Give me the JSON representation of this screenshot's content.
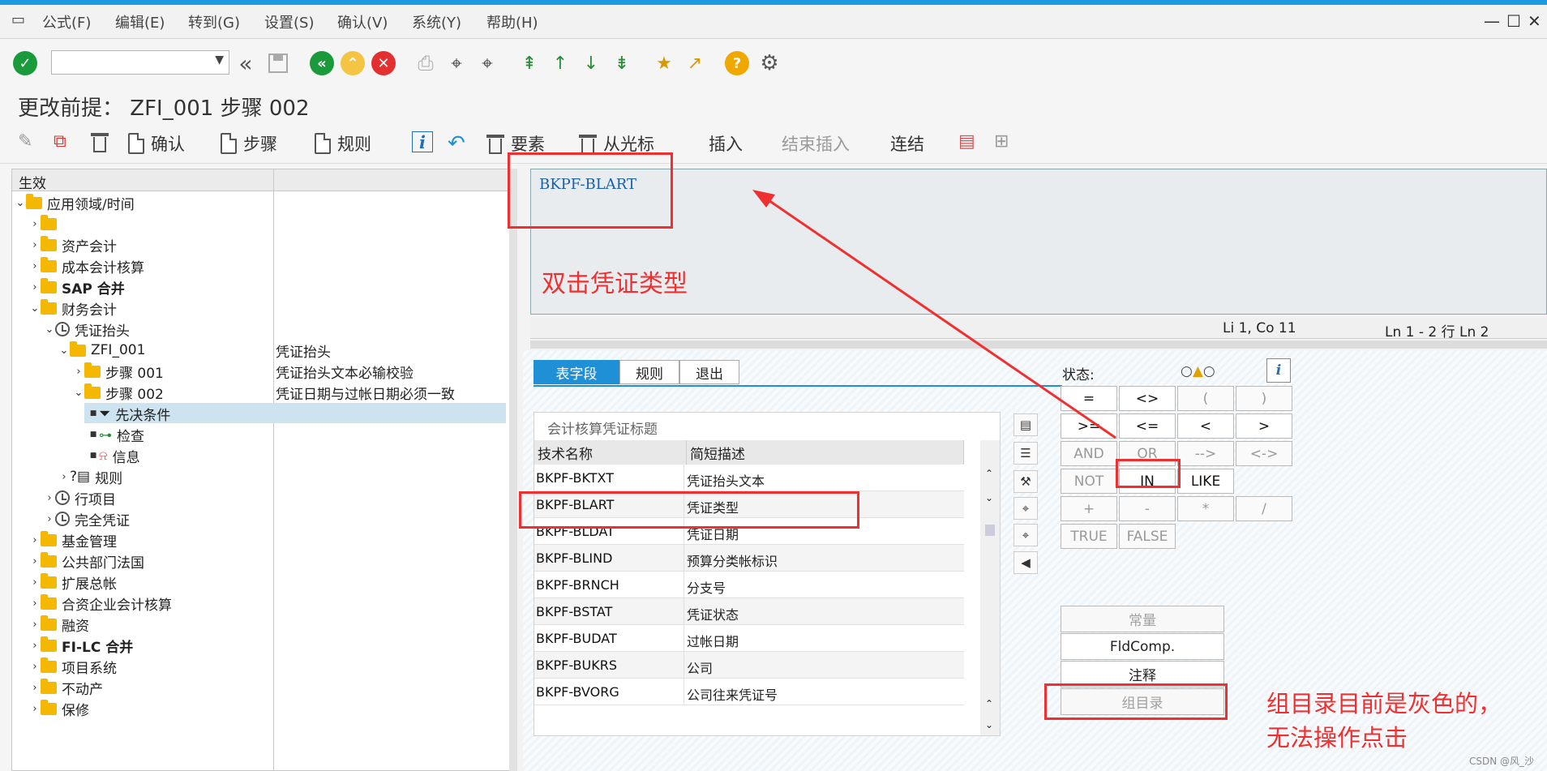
{
  "menu": [
    "公式(F)",
    "编辑(E)",
    "转到(G)",
    "设置(S)",
    "确认(V)",
    "系统(Y)",
    "帮助(H)"
  ],
  "title": "更改前提： ZFI_001 步骤 002",
  "app_toolbar": {
    "confirm": "确认",
    "step": "步骤",
    "rule": "规则",
    "element": "要素",
    "from_cursor": "从光标",
    "insert": "插入",
    "end_insert": "结束插入",
    "link": "连结"
  },
  "tree": {
    "header": "生效",
    "nodes": [
      {
        "label": "应用领域/时间",
        "level": 0,
        "expanded": true,
        "icon": "folder"
      },
      {
        "label": "",
        "level": 1,
        "icon": "folder"
      },
      {
        "label": "资产会计",
        "level": 1,
        "icon": "folder"
      },
      {
        "label": "成本会计核算",
        "level": 1,
        "icon": "folder"
      },
      {
        "label": "SAP 合并",
        "level": 1,
        "icon": "folder"
      },
      {
        "label": "财务会计",
        "level": 1,
        "expanded": true,
        "icon": "folder"
      },
      {
        "label": "凭证抬头",
        "level": 2,
        "expanded": true,
        "icon": "clock"
      },
      {
        "label": "ZFI_001",
        "level": 3,
        "expanded": true,
        "icon": "folder",
        "desc": "凭证抬头"
      },
      {
        "label": "步骤 001",
        "level": 4,
        "icon": "folder",
        "desc": "凭证抬头文本必输校验"
      },
      {
        "label": "步骤 002",
        "level": 4,
        "expanded": true,
        "icon": "folder",
        "desc": "凭证日期与过帐日期必须一致"
      },
      {
        "label": "先决条件",
        "level": 5,
        "icon": "filter",
        "selected": true
      },
      {
        "label": "检查",
        "level": 5,
        "icon": "check"
      },
      {
        "label": "信息",
        "level": 5,
        "icon": "message"
      },
      {
        "label": "规则",
        "level": 3,
        "icon": "rule"
      },
      {
        "label": "行项目",
        "level": 2,
        "icon": "clock"
      },
      {
        "label": "完全凭证",
        "level": 2,
        "icon": "clock"
      },
      {
        "label": "基金管理",
        "level": 1,
        "icon": "folder"
      },
      {
        "label": "公共部门法国",
        "level": 1,
        "icon": "folder"
      },
      {
        "label": "扩展总帐",
        "level": 1,
        "icon": "folder"
      },
      {
        "label": "合资企业会计核算",
        "level": 1,
        "icon": "folder"
      },
      {
        "label": "融资",
        "level": 1,
        "icon": "folder"
      },
      {
        "label": "FI-LC 合并",
        "level": 1,
        "icon": "folder"
      },
      {
        "label": "项目系统",
        "level": 1,
        "icon": "folder"
      },
      {
        "label": "不动产",
        "level": 1,
        "icon": "folder"
      },
      {
        "label": "保修",
        "level": 1,
        "icon": "folder"
      }
    ]
  },
  "editor": {
    "text": "BKPF-BLART",
    "cursor_pos": "Li 1, Co 11",
    "line_info": "Ln 1 - 2 行 Ln 2"
  },
  "tabs": [
    "表字段",
    "规则",
    "退出"
  ],
  "grid": {
    "title": "会计核算凭证标题",
    "col_tech": "技术名称",
    "col_desc": "简短描述",
    "rows": [
      {
        "tech": "BKPF-BKTXT",
        "desc": "凭证抬头文本"
      },
      {
        "tech": "BKPF-BLART",
        "desc": "凭证类型"
      },
      {
        "tech": "BKPF-BLDAT",
        "desc": "凭证日期"
      },
      {
        "tech": "BKPF-BLIND",
        "desc": "预算分类帐标识"
      },
      {
        "tech": "BKPF-BRNCH",
        "desc": "分支号"
      },
      {
        "tech": "BKPF-BSTAT",
        "desc": "凭证状态"
      },
      {
        "tech": "BKPF-BUDAT",
        "desc": "过帐日期"
      },
      {
        "tech": "BKPF-BUKRS",
        "desc": "公司"
      },
      {
        "tech": "BKPF-BVORG",
        "desc": "公司往来凭证号"
      }
    ]
  },
  "status_label": "状态:",
  "operators": [
    [
      "=",
      "<>",
      "(",
      ")"
    ],
    [
      ">=",
      "<=",
      "<",
      ">"
    ],
    [
      "AND",
      "OR",
      "-->",
      "<->"
    ],
    [
      "NOT",
      "IN",
      "LIKE"
    ],
    [
      "+",
      "-",
      "*",
      "/"
    ],
    [
      "TRUE",
      "FALSE"
    ]
  ],
  "operators_disabled": [
    "(",
    ")",
    "AND",
    "OR",
    "-->",
    "<->",
    "NOT",
    "+",
    "-",
    "*",
    "/",
    "TRUE",
    "FALSE"
  ],
  "big_buttons": {
    "constant": "常量",
    "fldcomp": "FldComp.",
    "comment": "注释",
    "group_dir": "组目录"
  },
  "annotations": {
    "dblclick": "双击凭证类型",
    "group_gray_1": "组目录目前是灰色的，",
    "group_gray_2": "无法操作点击"
  },
  "watermark": "CSDN @风_沙",
  "colors": {
    "accent_blue": "#1f8fd6",
    "annotation_red": "#f03030",
    "editor_text": "#1a5fa8",
    "folder": "#f5b800"
  }
}
